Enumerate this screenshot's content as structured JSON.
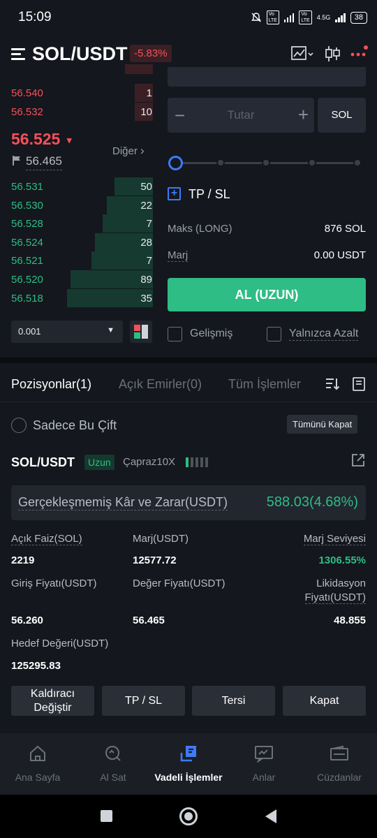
{
  "status_bar": {
    "time": "15:09",
    "network": "4.5G",
    "battery": "38"
  },
  "header": {
    "title": "SOL/USDT",
    "change": "-5.83%"
  },
  "order_book": {
    "asks": [
      {
        "price": "56.540",
        "qty": "1"
      },
      {
        "price": "56.532",
        "qty": "10"
      }
    ],
    "last_price": "56.525",
    "mark_price": "56.465",
    "more_label": "Diğer",
    "bids": [
      {
        "price": "56.531",
        "qty": "50",
        "depth": 0.25
      },
      {
        "price": "56.530",
        "qty": "22",
        "depth": 0.3
      },
      {
        "price": "56.528",
        "qty": "7",
        "depth": 0.33
      },
      {
        "price": "56.524",
        "qty": "28",
        "depth": 0.38
      },
      {
        "price": "56.521",
        "qty": "7",
        "depth": 0.4
      },
      {
        "price": "56.520",
        "qty": "89",
        "depth": 0.54
      },
      {
        "price": "56.518",
        "qty": "35",
        "depth": 0.56
      }
    ],
    "step": "0.001"
  },
  "order_form": {
    "amount_placeholder": "Tutar",
    "unit": "SOL",
    "tpsl_label": "TP / SL",
    "max_label": "Maks (LONG)",
    "max_value": "876 SOL",
    "margin_label": "Marj",
    "margin_value": "0.00 USDT",
    "buy_button": "AL (UZUN)",
    "advanced_label": "Gelişmiş",
    "reduce_only_label": "Yalnızca Azalt"
  },
  "tabs": [
    {
      "label": "Pozisyonlar(1)"
    },
    {
      "label": "Açık Emirler(0)"
    },
    {
      "label": "Tüm İşlemler"
    }
  ],
  "filter": {
    "only_pair_label": "Sadece Bu Çift",
    "close_all_label": "Tümünü Kapat"
  },
  "position": {
    "symbol": "SOL/USDT",
    "side": "Uzun",
    "leverage": "Çapraz10X",
    "pnl_label": "Gerçekleşmemiş Kâr ve Zarar(USDT)",
    "pnl_value": "588.03(4.68%)",
    "open_interest_label": "Açık Faiz(SOL)",
    "open_interest_value": "2219",
    "margin_label": "Marj(USDT)",
    "margin_value": "12577.72",
    "margin_level_label": "Marj Seviyesi",
    "margin_level_value": "1306.55%",
    "entry_label": "Giriş Fiyatı(USDT)",
    "entry_value": "56.260",
    "mark_label": "Değer Fiyatı(USDT)",
    "mark_value": "56.465",
    "liq_label_1": "Likidasyon",
    "liq_label_2": "Fiyatı(USDT)",
    "liq_value": "48.855",
    "target_label": "Hedef Değeri(USDT)",
    "target_value": "125295.83",
    "actions": [
      "Kaldıracı\nDeğiştir",
      "TP / SL",
      "Tersi",
      "Kapat"
    ]
  },
  "bottom_nav": [
    {
      "label": "Ana Sayfa",
      "icon": "home-icon"
    },
    {
      "label": "Al Sat",
      "icon": "trade-icon"
    },
    {
      "label": "Vadeli İşlemler",
      "icon": "futures-icon"
    },
    {
      "label": "Anlar",
      "icon": "moments-icon"
    },
    {
      "label": "Cüzdanlar",
      "icon": "wallet-icon"
    }
  ],
  "colors": {
    "up": "#2ebd85",
    "down": "#f5505a",
    "accent": "#3d7bf7",
    "bg": "#14171d"
  }
}
